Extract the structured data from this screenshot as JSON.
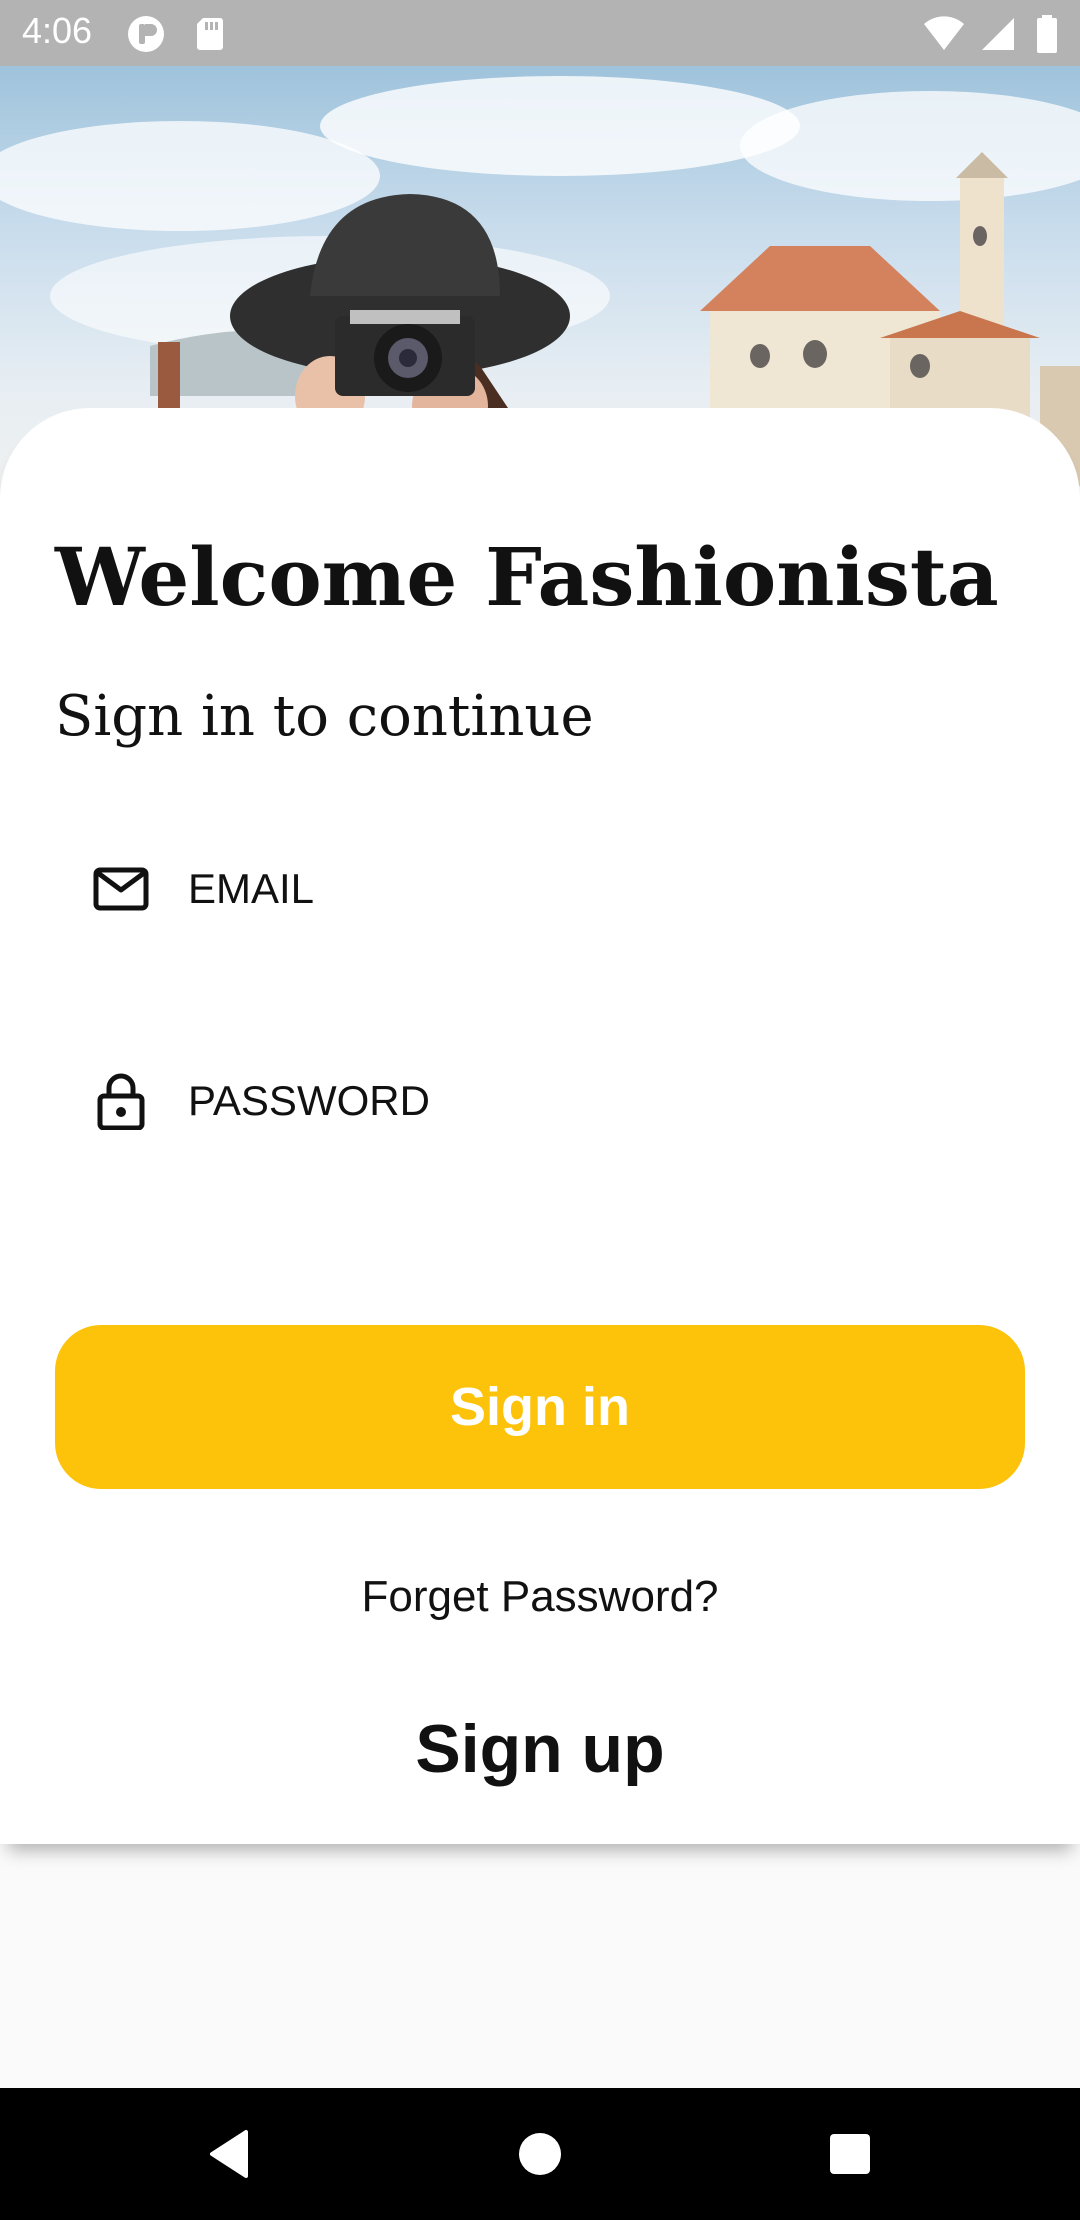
{
  "status_bar": {
    "time": "4:06",
    "left_icons": [
      "app-notification-icon",
      "sd-card-icon"
    ],
    "right_icons": [
      "wifi-icon",
      "signal-icon",
      "battery-icon"
    ]
  },
  "hero": {
    "description_icon": "photo-woman-with-camera"
  },
  "login": {
    "title": "Welcome Fashionista",
    "subtitle": "Sign in to continue",
    "email": {
      "placeholder": "EMAIL",
      "value": "",
      "icon": "mail-icon"
    },
    "password": {
      "placeholder": "PASSWORD",
      "value": "",
      "icon": "lock-icon"
    },
    "signin_label": "Sign in",
    "forget_label": "Forget Password?",
    "signup_label": "Sign up"
  },
  "colors": {
    "accent": "#fdc20a",
    "background": "#fafafa",
    "card": "#ffffff",
    "text": "#111111"
  },
  "nav_bar": {
    "buttons": [
      "back-icon",
      "home-icon",
      "recents-icon"
    ]
  }
}
